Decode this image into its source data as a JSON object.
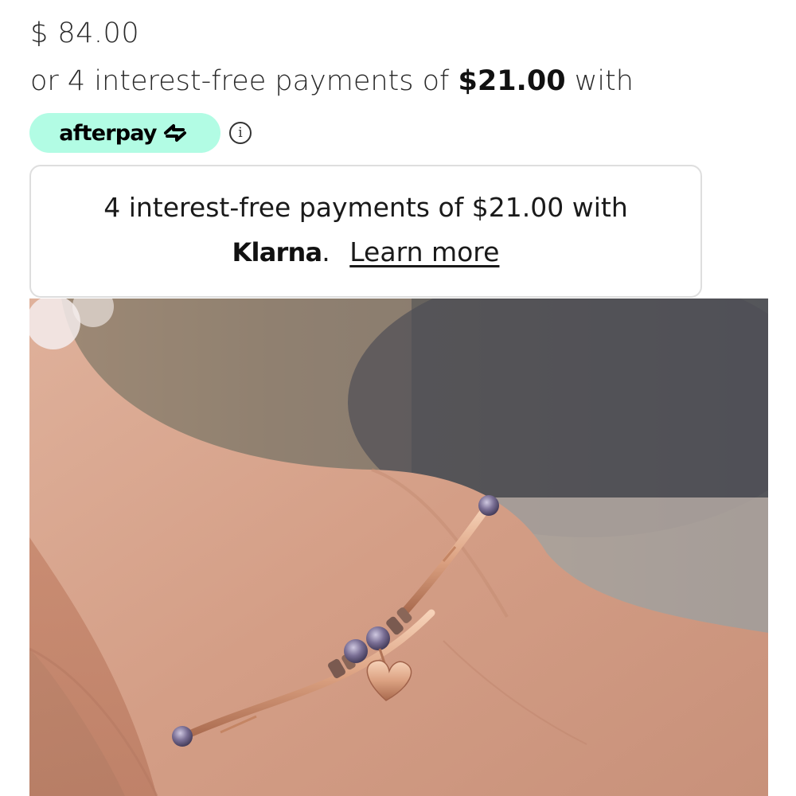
{
  "product": {
    "price": "$ 84.00",
    "installments": {
      "prefix": "or 4 interest-free payments of ",
      "amount": "$21.00",
      "suffix": " with"
    }
  },
  "afterpay": {
    "logo_text": "afterpay",
    "logo_icon": "afterpay-arrows-icon",
    "info_icon": "info-icon",
    "badge_color": "#b2fce4"
  },
  "klarna": {
    "message": "4 interest-free payments of $21.00 with",
    "logo_text": "Klarna",
    "logo_period": ".",
    "learn_more": "Learn more"
  },
  "image": {
    "subject": "product-photo",
    "skin_color": "#d7a48d",
    "background_color": "#5f5e5d",
    "metal_color": "#e3b08f"
  }
}
